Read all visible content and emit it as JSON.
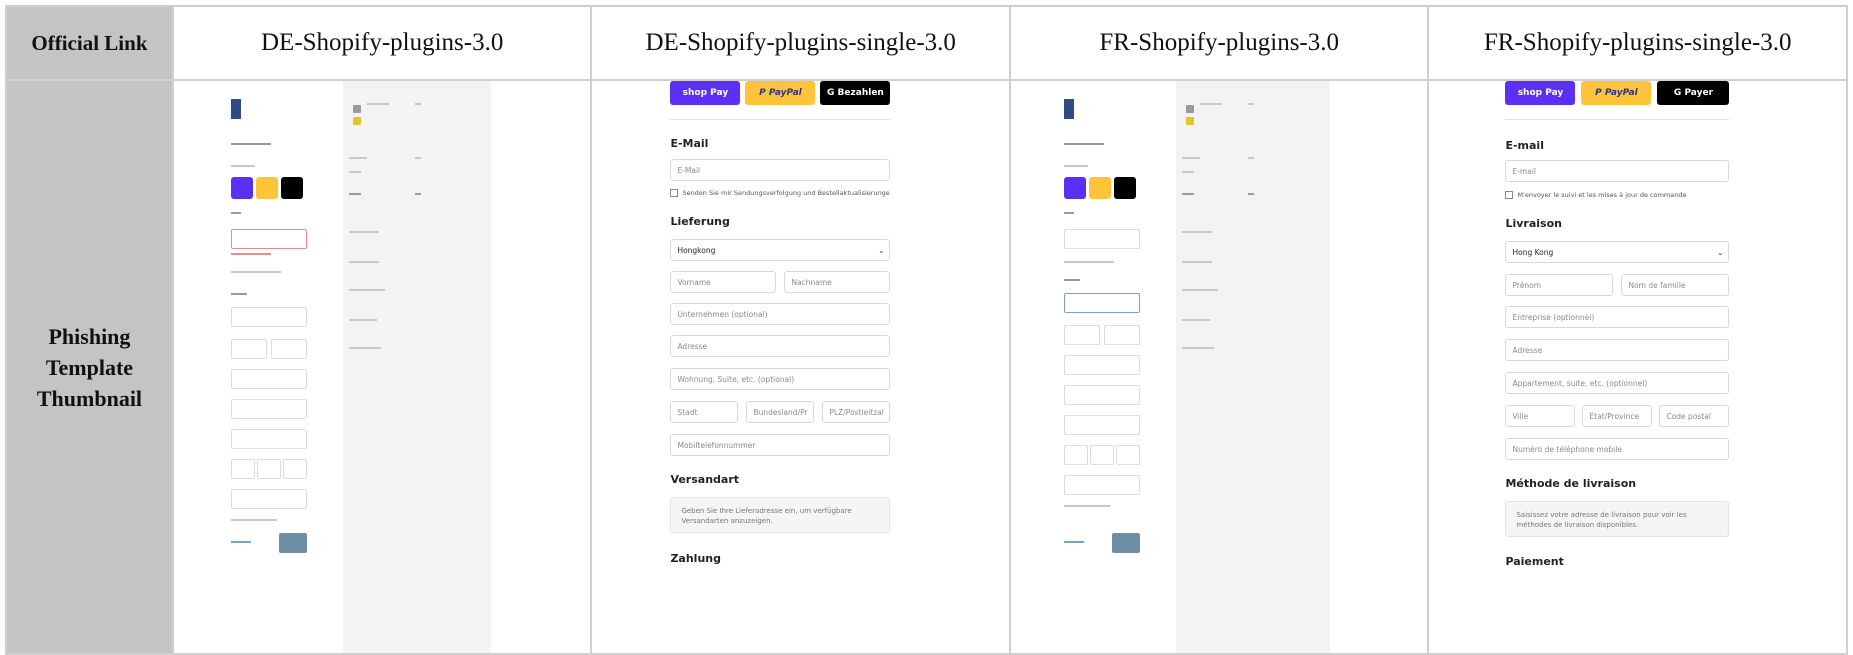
{
  "table": {
    "corner_label": "Official Link",
    "row_label_lines": [
      "Phishing",
      "Template",
      "Thumbnail"
    ],
    "columns": [
      "DE-Shopify-plugins-3.0",
      "DE-Shopify-plugins-single-3.0",
      "FR-Shopify-plugins-3.0",
      "FR-Shopify-plugins-single-3.0"
    ]
  },
  "de_single": {
    "pay": {
      "shop": "shop Pay",
      "paypal": "P PayPal",
      "gpay": "G Bezahlen"
    },
    "email_heading": "E-Mail",
    "email_placeholder": "E-Mail",
    "newsletter": "Senden Sie mir Sendungsverfolgung und Bestellaktualisierungen",
    "delivery_heading": "Lieferung",
    "country": "Hongkong",
    "first_name": "Vorname",
    "last_name": "Nachname",
    "company": "Unternehmen (optional)",
    "address": "Adresse",
    "apartment": "Wohnung, Suite, etc. (optional)",
    "city": "Stadt",
    "state": "Bundesland/Pr",
    "zip": "PLZ/Postleitzal",
    "phone": "Mobiltelefonnummer",
    "shipping_heading": "Versandart",
    "shipping_note": "Geben Sie Ihre Lieferadresse ein, um verfügbare Versandarten anzuzeigen.",
    "payment_heading": "Zahlung"
  },
  "fr_single": {
    "pay": {
      "shop": "shop Pay",
      "paypal": "P PayPal",
      "gpay": "G Payer"
    },
    "email_heading": "E-mail",
    "email_placeholder": "E-mail",
    "newsletter": "M'envoyer le suivi et les mises à jour de commande",
    "delivery_heading": "Livraison",
    "country": "Hong Kong",
    "first_name": "Prénom",
    "last_name": "Nom de famille",
    "company": "Entreprise (optionnel)",
    "address": "Adresse",
    "apartment": "Appartement, suite, etc. (optionnel)",
    "city": "Ville",
    "state": "État/Province",
    "zip": "Code postal",
    "phone": "Numéro de téléphone mobile",
    "shipping_heading": "Méthode de livraison",
    "shipping_note": "Saisissez votre adresse de livraison pour voir les méthodes de livraison disponibles.",
    "payment_heading": "Paiement"
  },
  "colors": {
    "header_gray": "#c4c4c4",
    "shop_pay": "#5a31f4",
    "paypal": "#ffc439",
    "gpay": "#000000",
    "error": "#e98b8b",
    "submit": "#6e8fa3"
  }
}
